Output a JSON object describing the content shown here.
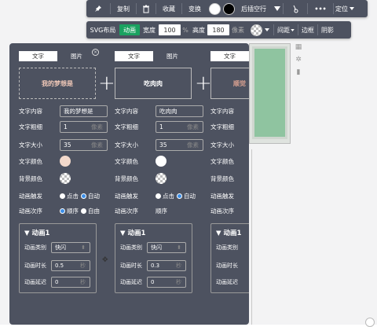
{
  "toolbar_top": {
    "pin_icon": "pin-icon",
    "copy": "复制",
    "delete_icon": "trash-icon",
    "collect": "收藏",
    "swap": "变换",
    "color_white": "#ffffff",
    "color_black": "#000000",
    "insert_after": "后插空行",
    "brush_icon": "brush-icon",
    "more": "•••",
    "locate": "定位"
  },
  "toolbar_second": {
    "svg_layout": "SVG布局",
    "animation": "动画",
    "width_label": "宽度",
    "width_value": "100",
    "width_unit": "%",
    "height_label": "高度",
    "height_value": "180",
    "height_unit": "像素",
    "spacing": "间距",
    "border": "边框",
    "shadow": "阴影"
  },
  "columns": [
    {
      "tab_text": "文字",
      "tab_image": "图片",
      "preview_text": "我的梦想是",
      "label_content": "文字内容",
      "content_value": "我的梦想是",
      "label_weight": "文字粗细",
      "weight_value": "1",
      "weight_unit": "像素",
      "label_size": "文字大小",
      "size_value": "35",
      "size_unit": "像素",
      "label_text_color": "文字颜色",
      "text_color": "#f3d9cb",
      "label_bg_color": "背景颜色",
      "label_trigger": "动画触发",
      "trigger_click": "点击",
      "trigger_auto": "自动",
      "label_order": "动画次序",
      "order_seq": "顺序",
      "order_free": "自由",
      "anim_title": "▼ 动画1",
      "label_type": "动画类别",
      "type_value": "快闪",
      "label_duration": "动画时长",
      "duration_value": "0.5",
      "duration_unit": "秒",
      "label_delay": "动画延迟",
      "delay_value": "0",
      "delay_unit": "秒"
    },
    {
      "tab_text": "文字",
      "tab_image": "图片",
      "preview_text": "吃肉肉",
      "label_content": "文字内容",
      "content_value": "吃肉肉",
      "label_weight": "文字粗细",
      "weight_value": "1",
      "weight_unit": "像素",
      "label_size": "文字大小",
      "size_value": "35",
      "size_unit": "像素",
      "label_text_color": "文字颜色",
      "text_color": "#ffffff",
      "label_bg_color": "背景颜色",
      "label_trigger": "动画触发",
      "trigger_click": "点击",
      "trigger_auto": "自动",
      "label_order": "动画次序",
      "order_seq": "顺序",
      "order_free": "",
      "anim_title": "▼ 动画1",
      "label_type": "动画类别",
      "type_value": "快闪",
      "label_duration": "动画时长",
      "duration_value": "0.3",
      "duration_unit": "秒",
      "label_delay": "动画延迟",
      "delay_value": "0",
      "delay_unit": "秒"
    },
    {
      "tab_text": "文字",
      "tab_image": "",
      "preview_text": "顺觉",
      "label_content": "文字内容",
      "content_value": "",
      "label_weight": "文字粗细",
      "weight_value": "",
      "weight_unit": "",
      "label_size": "文字大小",
      "size_value": "",
      "size_unit": "",
      "label_text_color": "文字颜色",
      "text_color": "#d8a090",
      "label_bg_color": "背景颜色",
      "label_trigger": "动画触发",
      "trigger_click": "",
      "trigger_auto": "",
      "label_order": "动画次序",
      "order_seq": "",
      "order_free": "",
      "anim_title": "▼ 动画1",
      "label_type": "动画类别",
      "type_value": "",
      "label_duration": "动画时长",
      "duration_value": "",
      "duration_unit": "",
      "label_delay": "动画延迟",
      "delay_value": "",
      "delay_unit": ""
    }
  ]
}
